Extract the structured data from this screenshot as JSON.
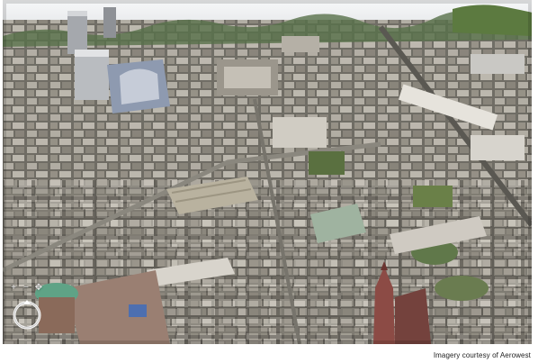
{
  "viewer": {
    "credit": "Imagery courtesy of Aerowest",
    "compass_icon": "compass-ring-icon",
    "nav_icons": [
      "zoom-in-icon",
      "zoom-out-icon",
      "pan-icon"
    ]
  },
  "colors": {
    "sky": "#f2f3f4",
    "ground": "#6c6a62",
    "roof_light": "#c8c4bc",
    "roof_dark": "#4e4c47",
    "trees": "#4f6a3a",
    "cathedral": "#8a4a45",
    "dome": "#5aa080"
  }
}
